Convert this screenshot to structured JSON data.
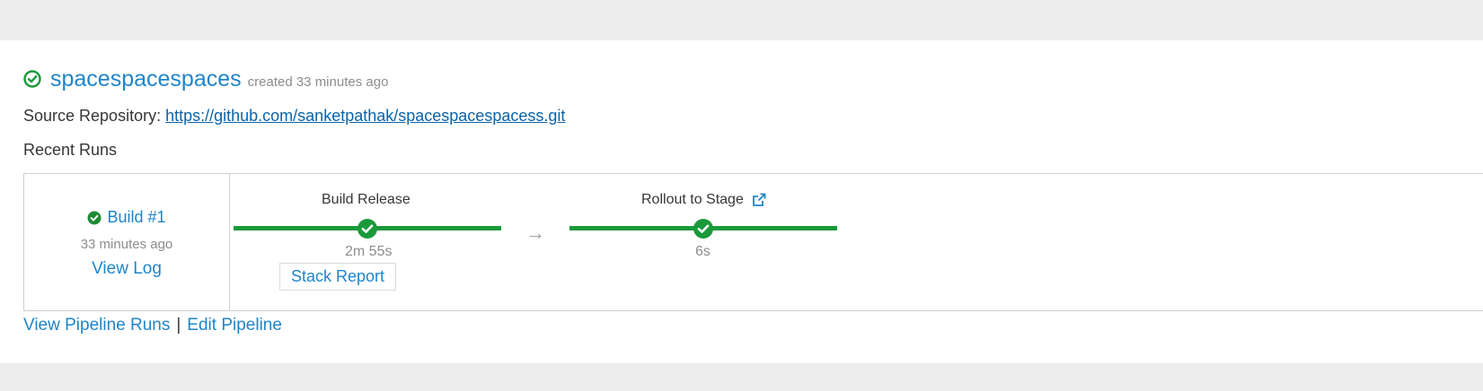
{
  "pipeline": {
    "name": "spacespacespaces",
    "created": "created 33 minutes ago",
    "source_label": "Source Repository:",
    "source_url": "https://github.com/sanketpathak/spacespacespacess.git",
    "recent_runs_label": "Recent Runs"
  },
  "run": {
    "build_label": "Build #1",
    "time": "33 minutes ago",
    "view_log": "View Log",
    "status_icon": "check-circle-icon"
  },
  "stages": [
    {
      "name": "Build Release",
      "duration": "2m 55s",
      "action": "Stack Report",
      "status_icon": "check-circle-icon"
    },
    {
      "name": "Rollout to Stage",
      "duration": "6s",
      "status_icon": "check-circle-icon",
      "link_icon": "external-link-icon"
    }
  ],
  "connector": "→",
  "footer": {
    "view_runs": "View Pipeline Runs",
    "separator": "|",
    "edit": "Edit Pipeline"
  },
  "colors": {
    "success": "#1a9a3a",
    "link": "#1f85c9",
    "background": "#ededed"
  }
}
